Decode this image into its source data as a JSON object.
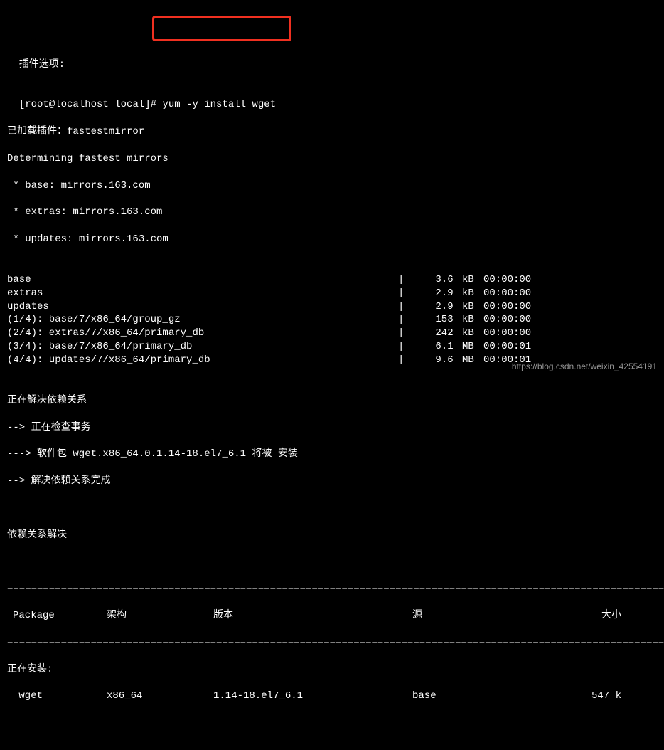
{
  "pre1": "  插件选项:",
  "prompt_user": "[root@localhost local]#",
  "prompt_cmd": " yum -y install wget",
  "pre2": "已加载插件：fastestmirror",
  "pre3": "Determining fastest mirrors",
  "mirror1": " * base: mirrors.163.com",
  "mirror2": " * extras: mirrors.163.com",
  "mirror3": " * updates: mirrors.163.com",
  "repos": [
    {
      "name": "base",
      "size": "3.6",
      "unit": "kB",
      "time": "00:00:00"
    },
    {
      "name": "extras",
      "size": "2.9",
      "unit": "kB",
      "time": "00:00:00"
    },
    {
      "name": "updates",
      "size": "2.9",
      "unit": "kB",
      "time": "00:00:00"
    },
    {
      "name": "(1/4): base/7/x86_64/group_gz",
      "size": "153",
      "unit": "kB",
      "time": "00:00:00"
    },
    {
      "name": "(2/4): extras/7/x86_64/primary_db",
      "size": "242",
      "unit": "kB",
      "time": "00:00:00"
    },
    {
      "name": "(3/4): base/7/x86_64/primary_db",
      "size": "6.1",
      "unit": "MB",
      "time": "00:00:01"
    },
    {
      "name": "(4/4): updates/7/x86_64/primary_db",
      "size": "9.6",
      "unit": "MB",
      "time": "00:00:01"
    }
  ],
  "resolve1": "正在解决依赖关系",
  "resolve2": "--> 正在检查事务",
  "resolve3": "---> 软件包 wget.x86_64.0.1.14-18.el7_6.1 将被 安装",
  "resolve4": "--> 解决依赖关系完成",
  "resolve5": "依赖关系解决",
  "divider": "==================================================================================================================",
  "headers": {
    "pkg": "Package",
    "arch": "架构",
    "ver": "版本",
    "repo": "源",
    "size": "大小"
  },
  "installing": "正在安装:",
  "pkg_row": {
    "pkg": " wget",
    "arch": "x86_64",
    "ver": "1.14-18.el7_6.1",
    "repo": "base",
    "size": "547 k"
  },
  "watermark": "https://blog.csdn.net/weixin_42554191"
}
